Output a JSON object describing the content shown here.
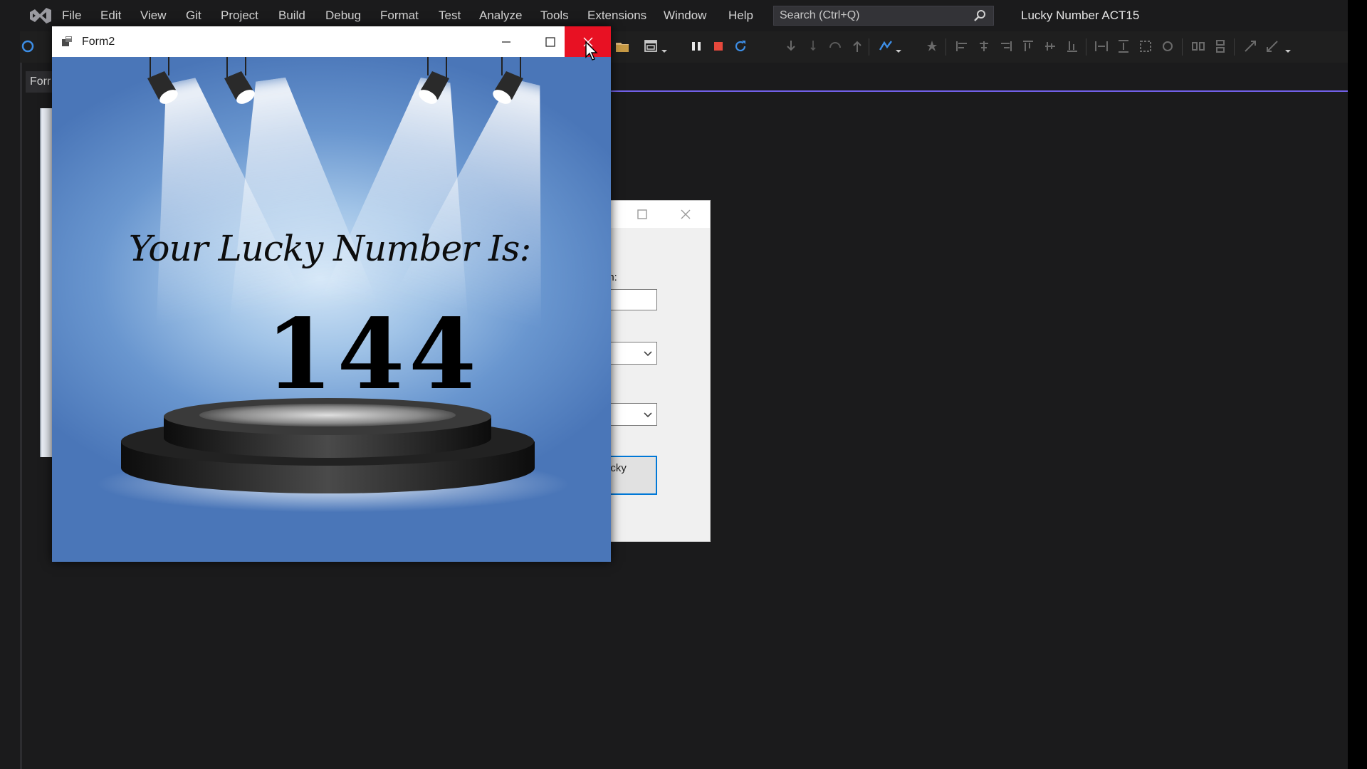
{
  "ide": {
    "menu": [
      "File",
      "Edit",
      "View",
      "Git",
      "Project",
      "Build",
      "Debug",
      "Format",
      "Test",
      "Analyze",
      "Tools",
      "Extensions",
      "Window",
      "Help"
    ],
    "search_placeholder": "Search (Ctrl+Q)",
    "solution_title": "Lucky Number ACT15",
    "doc_tab_label": "Forr"
  },
  "form1": {
    "label_fragment": "orn:",
    "button_text_fragment": "ucky\n?"
  },
  "form2": {
    "title": "Form2",
    "heading": "Your Lucky Number Is:",
    "lucky_number": "144"
  },
  "colors": {
    "close_hover": "#e81123",
    "accent": "#7160e8",
    "ide_bg": "#1b1b1c"
  }
}
